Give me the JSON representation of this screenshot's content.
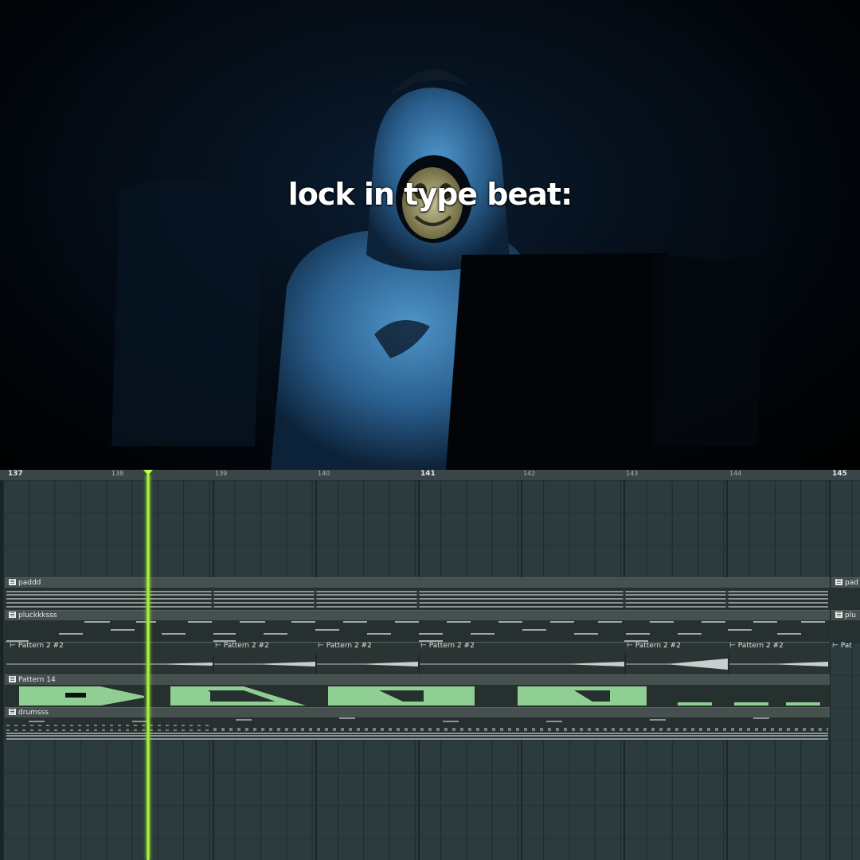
{
  "caption": "lock in type beat:",
  "ruler": {
    "bars": [
      {
        "label": "137",
        "major": true
      },
      {
        "label": "138",
        "major": false
      },
      {
        "label": "139",
        "major": false
      },
      {
        "label": "140",
        "major": false
      },
      {
        "label": "141",
        "major": true
      },
      {
        "label": "142",
        "major": false
      },
      {
        "label": "143",
        "major": false
      },
      {
        "label": "144",
        "major": false
      },
      {
        "label": "145",
        "major": true
      }
    ]
  },
  "clips": [
    {
      "name": "paddd",
      "stub": "pad"
    },
    {
      "name": "pluckkksss",
      "stub": "plu"
    },
    {
      "name": "Pattern 2 #2",
      "stub": "Pat"
    },
    {
      "name": "Pattern 14",
      "stub": ""
    },
    {
      "name": "drumsss",
      "stub": ""
    }
  ],
  "pattern_instances": [
    "Pattern 2 #2",
    "Pattern 2 #2",
    "Pattern 2 #2",
    "Pattern 2 #2",
    "Pattern 2 #2",
    "Pattern 2 #2",
    "Pattern 2 #2"
  ],
  "colors": {
    "playhead": "#b8ff4a",
    "note_green": "#8fcf94",
    "grid_bg": "#2c3b3e"
  }
}
